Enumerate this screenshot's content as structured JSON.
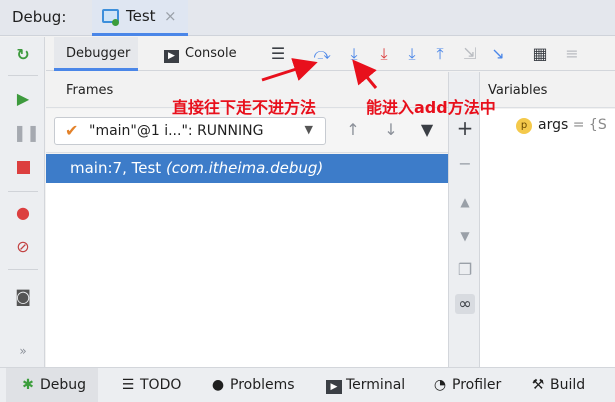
{
  "titlebar": {
    "debug_label": "Debug:",
    "tab_label": "Test",
    "tab_close": "×"
  },
  "toolbar": {
    "debugger_tab": "Debugger",
    "console_tab": "Console"
  },
  "frames": {
    "header": "Frames",
    "thread_select": "\"main\"@1 i...\": RUNNING",
    "rows": [
      {
        "location": "main:7, Test",
        "package": "(com.itheima.debug)"
      }
    ]
  },
  "variables": {
    "header": "Variables",
    "items": [
      {
        "badge": "p",
        "name": "args",
        "value": " = {S"
      }
    ]
  },
  "annotations": {
    "left": "直接往下走不进方法",
    "right": "能进入add方法中"
  },
  "bottombar": {
    "items": [
      "Debug",
      "TODO",
      "Problems",
      "Terminal",
      "Profiler",
      "Build"
    ]
  },
  "colors": {
    "accent": "#4a86e8",
    "selection": "#3d7cc9",
    "annotation": "#e8101c"
  }
}
